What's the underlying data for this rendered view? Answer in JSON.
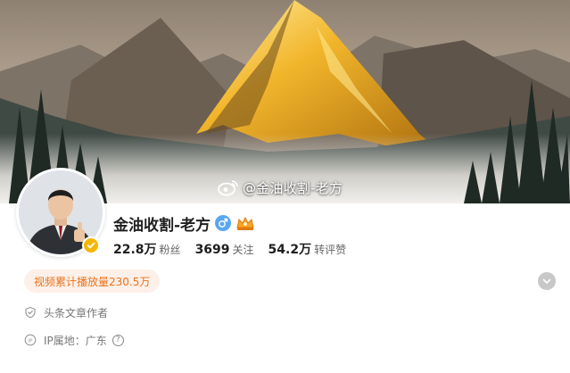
{
  "profile": {
    "name": "金油收割-老方",
    "watermark_handle": "@金油收割-老方",
    "gender_icon": "male-icon",
    "verified_icon": "verified-badge-icon",
    "level_icon": "level-crown-icon"
  },
  "stats": [
    {
      "value": "22.8万",
      "label": "粉丝"
    },
    {
      "value": "3699",
      "label": "关注"
    },
    {
      "value": "54.2万",
      "label": "转评赞"
    }
  ],
  "play_count_text": "视频累计播放量230.5万",
  "info": {
    "author_label": "头条文章作者",
    "ip_label": "IP属地：广东"
  },
  "colors": {
    "accent_orange": "#e8731f",
    "pill_bg": "#fdf0e8",
    "verified_gold": "#f6b500",
    "gender_blue": "#5aa7f0"
  }
}
